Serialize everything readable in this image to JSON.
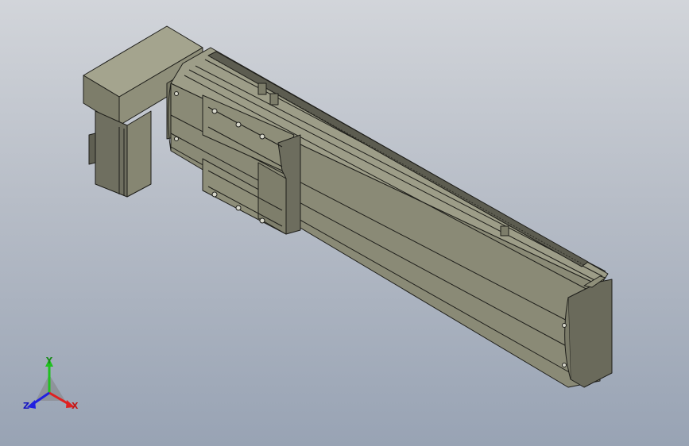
{
  "viewport": {
    "background_top": "#d2d5da",
    "background_bottom": "#98a3b4"
  },
  "model": {
    "body_color": "#8f8f7a",
    "body_dark": "#6f6f60",
    "body_shadow": "#55554a",
    "top_face": "#a4a48e",
    "edge_color": "#1e1e1a"
  },
  "triad": {
    "x_label": "X",
    "y_label": "Y",
    "z_label": "Z",
    "x_color": "#e02020",
    "y_color": "#20c020",
    "z_color": "#2020e0"
  }
}
